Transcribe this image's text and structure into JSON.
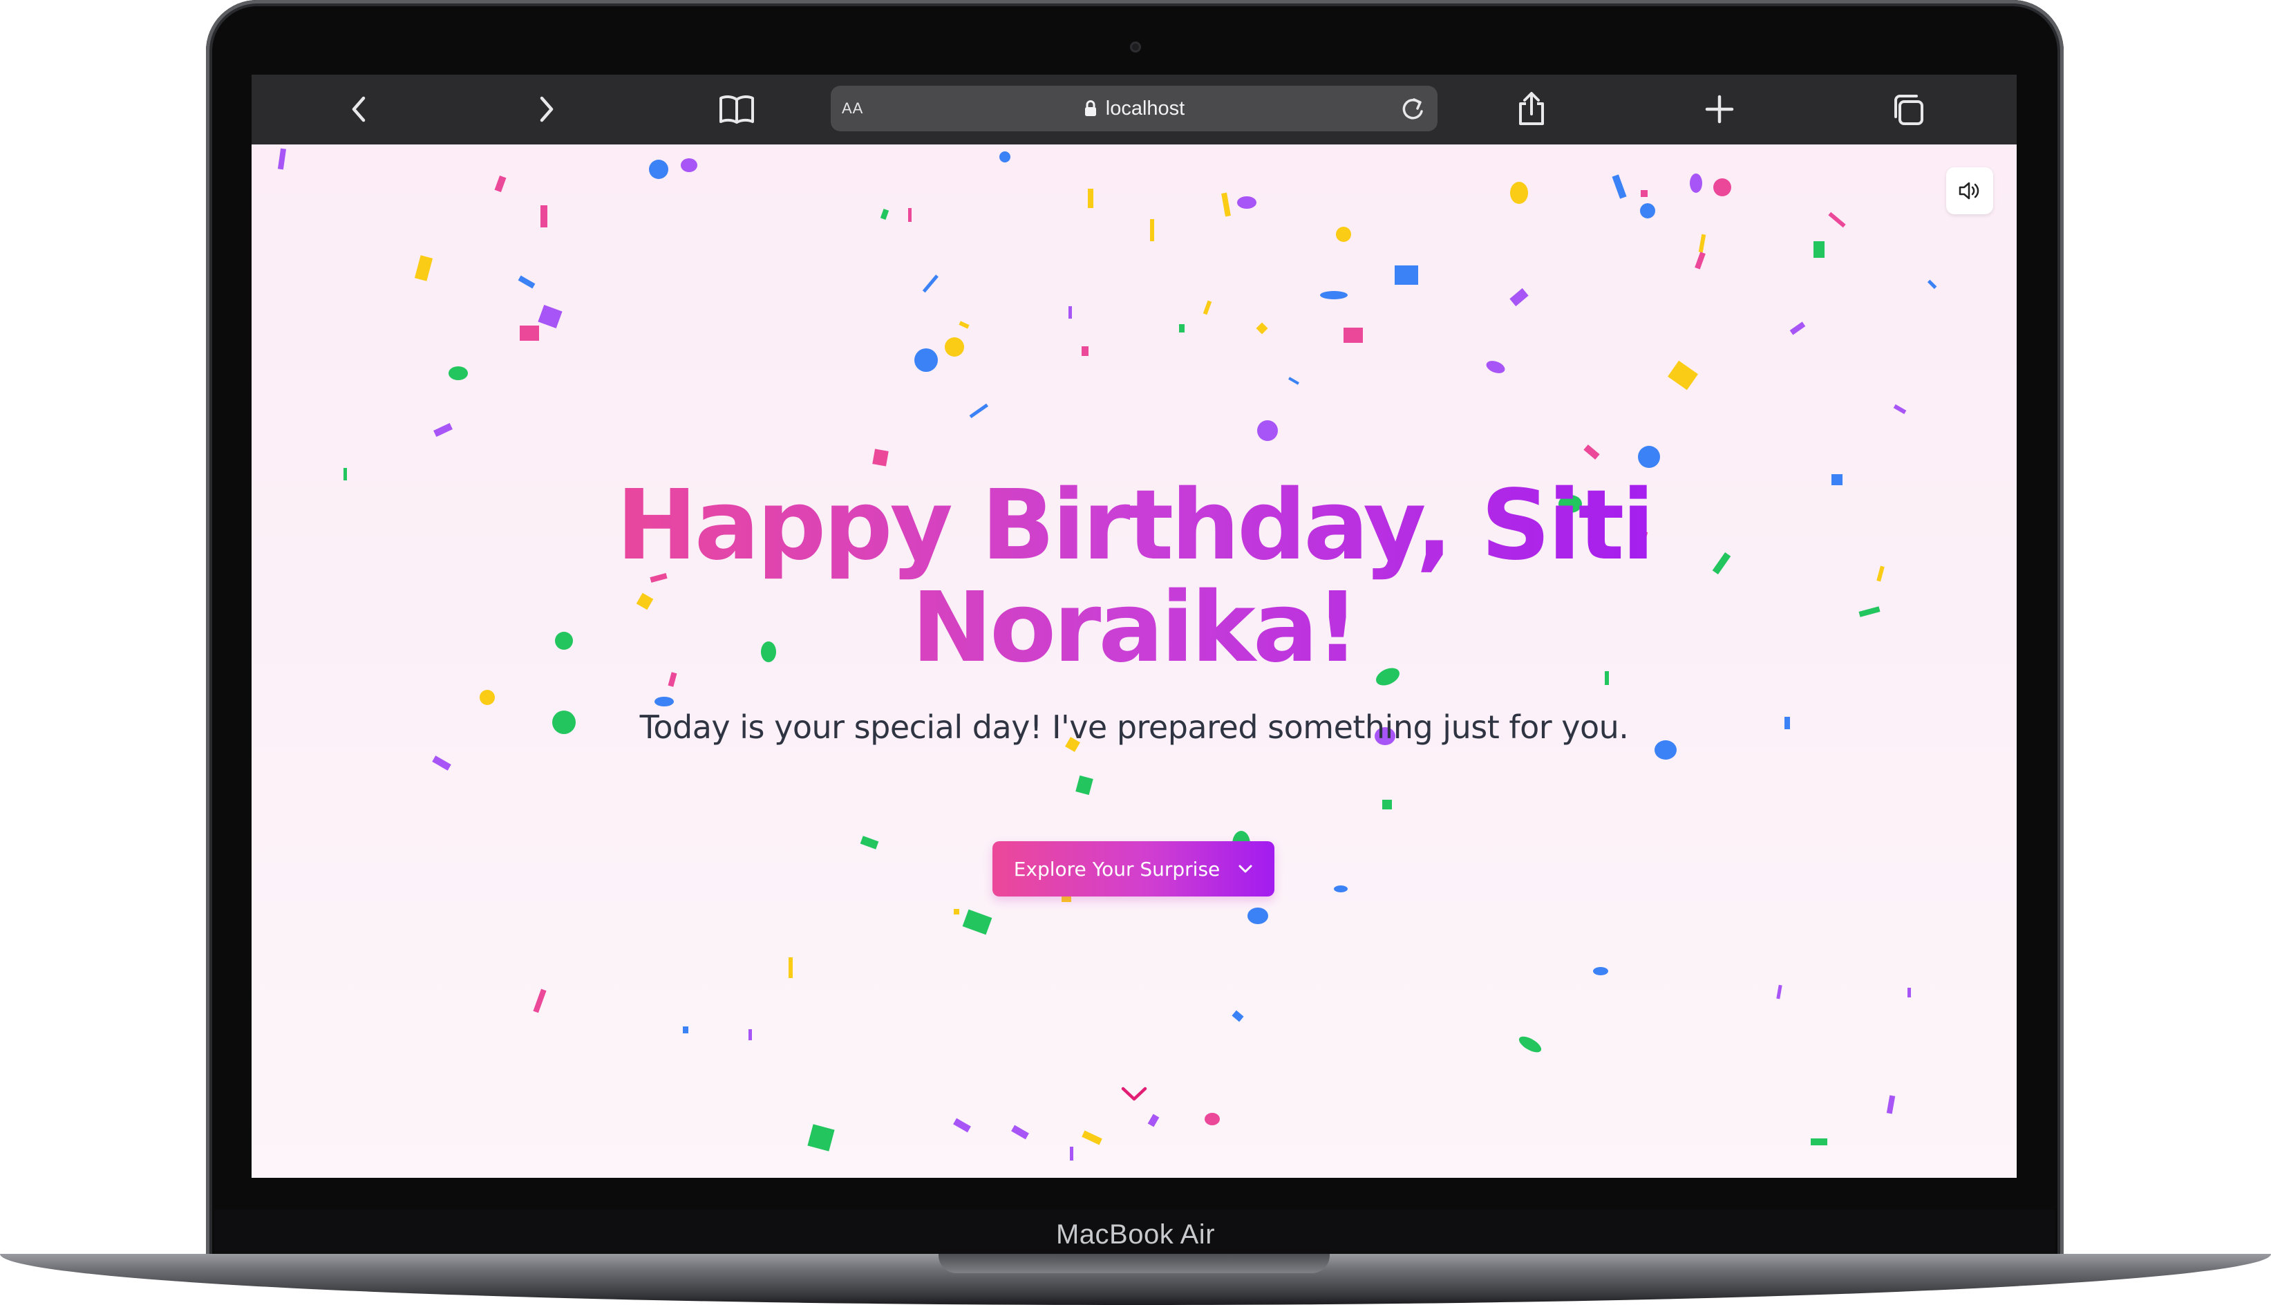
{
  "device": {
    "model_label": "MacBook Air"
  },
  "browser": {
    "aa_label": "AA",
    "url": "localhost",
    "icons": {
      "back": "chevron-left-icon",
      "forward": "chevron-right-icon",
      "bookmarks": "book-icon",
      "lock": "lock-icon",
      "reload": "reload-icon",
      "share": "share-icon",
      "new_tab": "plus-icon",
      "tabs": "tabs-icon"
    }
  },
  "page": {
    "title": "Happy Birthday, Siti Noraika!",
    "subtitle": "Today is your special day! I've prepared something just for you.",
    "cta_label": "Explore Your Surprise",
    "sound_icon": "speaker-icon",
    "scroll_icon": "chevron-down-icon"
  },
  "colors": {
    "accent_pink": "#ec4899",
    "accent_purple": "#a21cf0",
    "page_background": "#fcedf6",
    "toolbar_background": "#2b2b2d",
    "confetti": [
      "#3b82f6",
      "#facc15",
      "#22c55e",
      "#ec4899",
      "#a855f7"
    ]
  }
}
